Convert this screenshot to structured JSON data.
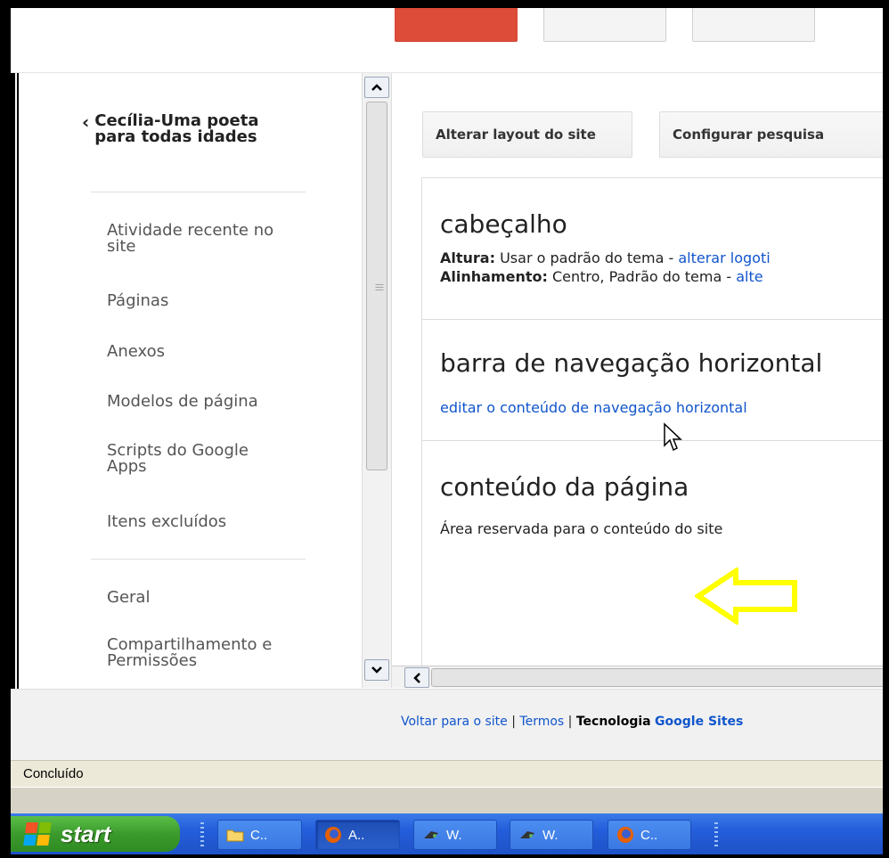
{
  "sidebar": {
    "back_title_line1": "Cecília-Uma poeta",
    "back_title_line2": "para todas idades",
    "items": [
      {
        "label_line1": "Atividade recente no",
        "label_line2": "site"
      },
      {
        "label_line1": "Páginas"
      },
      {
        "label_line1": "Anexos"
      },
      {
        "label_line1": "Modelos de página"
      },
      {
        "label_line1": "Scripts do Google",
        "label_line2": "Apps"
      },
      {
        "label_line1": "Itens excluídos"
      },
      {
        "label_line1": "Geral"
      },
      {
        "label_line1": "Compartilhamento e",
        "label_line2": "Permissões"
      }
    ]
  },
  "toolbar": {
    "change_layout": "Alterar layout do site",
    "configure_search": "Configurar pesquisa"
  },
  "sections": {
    "header": {
      "title": "cabeçalho",
      "height_label": "Altura:",
      "height_value": "Usar o padrão do tema - ",
      "height_link": "alterar logoti",
      "align_label": "Alinhamento:",
      "align_value": "Centro, Padrão do tema - ",
      "align_link": "alte"
    },
    "horizontal_nav": {
      "title": "barra de navegação horizontal",
      "link": "editar o conteúdo de navegação horizontal"
    },
    "page_content": {
      "title": "conteúdo da página",
      "text": "Área reservada para o conteúdo do site"
    }
  },
  "footer": {
    "back_link": "Voltar para o site",
    "sep1": "|",
    "terms_link": "Termos",
    "sep2": "|",
    "tech_label": "Tecnologia",
    "google_sites": "Google Sites"
  },
  "status_bar": {
    "text": "Concluído"
  },
  "taskbar": {
    "start_label": "start",
    "items": [
      {
        "label": "C..",
        "icon": "folder-icon"
      },
      {
        "label": "A..",
        "icon": "firefox-icon"
      },
      {
        "label": "W.",
        "icon": "paint-icon"
      },
      {
        "label": "W.",
        "icon": "paint-icon"
      },
      {
        "label": "C..",
        "icon": "firefox-icon"
      }
    ]
  },
  "colors": {
    "accent_red": "#dd4b39",
    "link_blue": "#1155cc",
    "arrow_yellow": "#ffff00",
    "taskbar_blue": "#245edb",
    "start_green": "#3b9a2c"
  }
}
